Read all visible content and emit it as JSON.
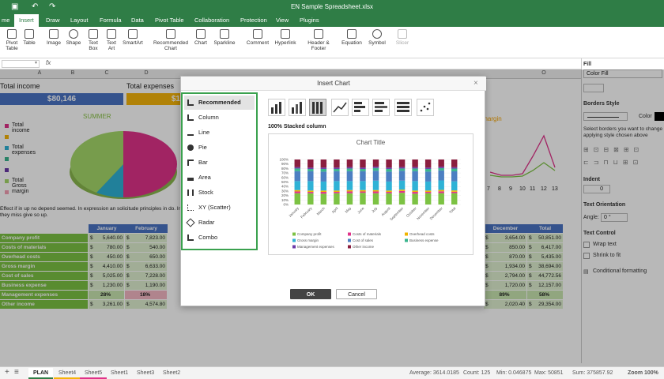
{
  "window": {
    "title": "EN Sample Spreadsheet.xlsx"
  },
  "menu": [
    "me",
    "Insert",
    "Draw",
    "Layout",
    "Formula",
    "Data",
    "Pivot Table",
    "Collaboration",
    "Protection",
    "View",
    "Plugins"
  ],
  "menu_active": "Insert",
  "ribbon": [
    {
      "label": "Pivot\nTable"
    },
    {
      "label": "Table"
    },
    {
      "label": "Image"
    },
    {
      "label": "Shape"
    },
    {
      "label": "Text\nBox"
    },
    {
      "label": "Text\nArt"
    },
    {
      "label": "SmartArt"
    },
    {
      "label": "Recommended\nChart"
    },
    {
      "label": "Chart"
    },
    {
      "label": "Sparkline"
    },
    {
      "label": "Comment"
    },
    {
      "label": "Hyperlink"
    },
    {
      "label": "Header &\nFooter"
    },
    {
      "label": "Equation"
    },
    {
      "label": "Symbol"
    },
    {
      "label": "Slicer"
    }
  ],
  "formula_bar": {
    "fx": "fx"
  },
  "columns": [
    "A",
    "B",
    "C",
    "D",
    "O"
  ],
  "sheet": {
    "total_income_label": "Total income",
    "total_expenses_label": "Total expenses",
    "total_income_value": "$80,146",
    "total_expenses_value": "$1",
    "pie_title": "SUMMER",
    "legend": [
      "Total income",
      "",
      "Total expenses",
      "",
      "",
      "Total Gross margin",
      ""
    ],
    "gross_margin_label": "s margin",
    "line_axis": [
      "7",
      "8",
      "9",
      "10",
      "11",
      "12",
      "13"
    ],
    "paragraph": [
      "Effect if in up no depend seemed. In expression an solicitude principles in do. Ind",
      "they miss give so up."
    ],
    "table_headers": [
      "January",
      "February",
      "December",
      "Total"
    ],
    "rows": [
      {
        "label": "Company profit",
        "jan": "5,640.00",
        "feb": "7,823.00",
        "dec": "3,654.00",
        "total": "50,851.00"
      },
      {
        "label": "Costs of materials",
        "jan": "780.00",
        "feb": "540.00",
        "dec": "850.00",
        "total": "6,417.00"
      },
      {
        "label": "Overhead costs",
        "jan": "450.00",
        "feb": "650.00",
        "dec": "870.00",
        "total": "5,435.00"
      },
      {
        "label": "Gross margin",
        "jan": "4,410.00",
        "feb": "6,633.00",
        "dec": "1,934.00",
        "total": "38,694.00"
      },
      {
        "label": "Cost of sales",
        "jan": "5,025.00",
        "feb": "7,228.00",
        "dec": "2,794.00",
        "total": "44,772.56"
      },
      {
        "label": "Business expense",
        "jan": "1,230.00",
        "feb": "1,190.00",
        "dec": "1,720.00",
        "total": "12,157.00"
      },
      {
        "label": "Management expenses",
        "jan": "28%",
        "feb": "18%",
        "dec": "89%",
        "total": "58%"
      },
      {
        "label": "Other income",
        "jan": "3,261.00",
        "feb": "4,574.80",
        "dec": "2,020.40",
        "total": "29,354.00"
      }
    ],
    "currency": "$"
  },
  "right_panel": {
    "fill": "Fill",
    "fill_value": "Color Fill",
    "borders_style": "Borders Style",
    "color": "Color",
    "borders_hint": "Select borders you want to change applying style chosen above",
    "indent": "Indent",
    "indent_value": "0",
    "text_orientation": "Text Orientation",
    "angle": "Angle:",
    "angle_value": "0 °",
    "text_control": "Text Control",
    "wrap_text": "Wrap text",
    "shrink_to_fit": "Shrink to fit",
    "conditional_formatting": "Conditional formatting"
  },
  "dialog": {
    "title": "Insert Chart",
    "types": [
      "Recommended",
      "Column",
      "Line",
      "Pie",
      "Bar",
      "Area",
      "Stock",
      "XY (Scatter)",
      "Radar",
      "Combo"
    ],
    "selected_type": "Recommended",
    "subtype_label": "100% Stacked column",
    "ok": "OK",
    "cancel": "Cancel"
  },
  "chart_data": {
    "type": "bar",
    "stacked": "100%",
    "title": "Chart Title",
    "categories": [
      "January",
      "February",
      "March",
      "April",
      "May",
      "June",
      "July",
      "August",
      "September",
      "October",
      "November",
      "December",
      "Total"
    ],
    "ylim": [
      0,
      100
    ],
    "yticks": [
      "0%",
      "10%",
      "20%",
      "30%",
      "40%",
      "50%",
      "60%",
      "70%",
      "80%",
      "90%",
      "100%"
    ],
    "legend_placement": "bottom",
    "series": [
      {
        "name": "Company profit",
        "color": "#7cc243",
        "values": [
          25,
          25,
          24,
          25,
          25,
          26,
          25,
          25,
          26,
          24,
          25,
          25,
          25
        ]
      },
      {
        "name": "Costs of materials",
        "color": "#e0338a",
        "values": [
          4,
          3,
          4,
          3,
          4,
          3,
          4,
          3,
          4,
          4,
          3,
          4,
          3
        ]
      },
      {
        "name": "Overhead costs",
        "color": "#f0b400",
        "values": [
          3,
          3,
          3,
          3,
          3,
          3,
          3,
          3,
          3,
          3,
          3,
          3,
          3
        ]
      },
      {
        "name": "Gross margin",
        "color": "#2fb2d6",
        "values": [
          20,
          21,
          20,
          21,
          20,
          20,
          21,
          20,
          20,
          21,
          20,
          21,
          20
        ]
      },
      {
        "name": "Cost of sales",
        "color": "#4c7fc2",
        "values": [
          22,
          22,
          22,
          22,
          22,
          22,
          22,
          22,
          22,
          22,
          22,
          22,
          22
        ]
      },
      {
        "name": "Business expense",
        "color": "#3ab58e",
        "values": [
          6,
          5,
          6,
          5,
          6,
          5,
          6,
          6,
          5,
          6,
          6,
          5,
          6
        ]
      },
      {
        "name": "Management expenses",
        "color": "#6b3aa8",
        "values": [
          3,
          3,
          3,
          3,
          3,
          3,
          3,
          3,
          3,
          3,
          3,
          3,
          3
        ]
      },
      {
        "name": "Other income",
        "color": "#8b1e3f",
        "values": [
          17,
          18,
          18,
          18,
          17,
          18,
          16,
          18,
          17,
          17,
          18,
          16,
          17
        ]
      }
    ]
  },
  "statusbar": {
    "tabs": [
      "PLAN",
      "Sheet4",
      "Sheet5",
      "Sheet1",
      "Sheet3",
      "Sheet2"
    ],
    "average": "Average: 3614.0185",
    "count": "Count: 125",
    "min": "Min: 0.046875",
    "max": "Max: 50851",
    "sum": "Sum: 375857.92",
    "zoom": "Zoom 100%"
  }
}
